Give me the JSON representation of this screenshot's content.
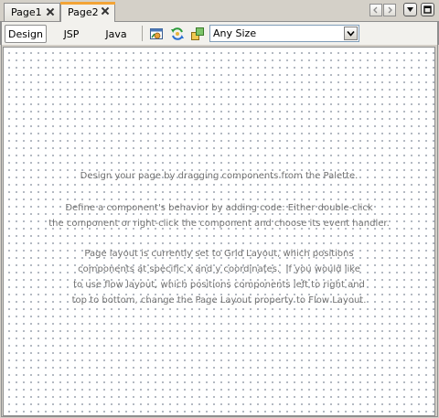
{
  "tabs": [
    {
      "label": "Page1",
      "active": false
    },
    {
      "label": "Page2",
      "active": true
    }
  ],
  "icons": {
    "tab_close": "close-icon",
    "scroll_left": "arrow-left-icon",
    "scroll_right": "arrow-right-icon",
    "tab_list": "dropdown-arrow-icon",
    "maximize": "maximize-icon",
    "preview": "preview-in-browser-icon",
    "refresh": "refresh-icon",
    "background": "show-background-icon",
    "combo_arrow": "chevron-down-icon"
  },
  "view_tabs": [
    {
      "label": "Design",
      "active": true
    },
    {
      "label": "JSP",
      "active": false
    },
    {
      "label": "Java",
      "active": false
    }
  ],
  "size_select": {
    "value": "Any Size"
  },
  "hints": {
    "p1": "Design your page by dragging components from the Palette.",
    "p2": "Define a component's behavior by adding code: Either double-click\nthe component or right-click the component and choose its event handler.",
    "p3": "Page layout is currently set to Grid Layout, which positions\ncomponents at specific x and y coordinates.  If you would like\nto use flow layout, which positions components left to right and\ntop to bottom, change the Page Layout property to Flow Layout."
  },
  "colors": {
    "active_tab_accent": "#f3a436",
    "window_bg": "#d4d0c8",
    "hint_text": "#707070",
    "grid_dot": "#9aa2ad"
  }
}
